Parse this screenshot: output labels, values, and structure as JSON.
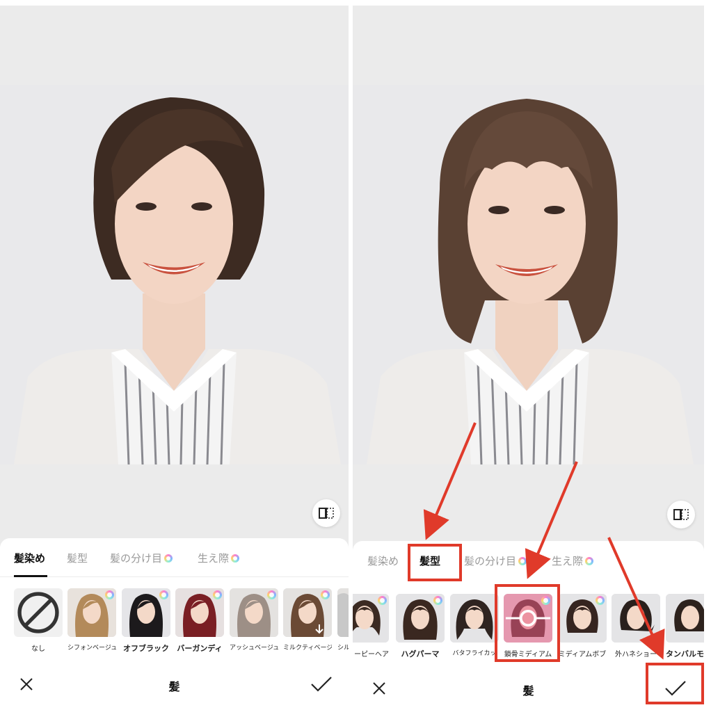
{
  "left_screen": {
    "tabs": [
      {
        "label": "髪染め",
        "active": true,
        "premium": false
      },
      {
        "label": "髪型",
        "active": false,
        "premium": false
      },
      {
        "label": "髪の分け目",
        "active": false,
        "premium": true
      },
      {
        "label": "生え際",
        "active": false,
        "premium": true
      }
    ],
    "items": [
      {
        "label": "なし",
        "type": "none"
      },
      {
        "label": "シフォンベージュ",
        "hair": "#b38a5a",
        "premium": true
      },
      {
        "label": "オフブラック",
        "hair": "#1c1a1c",
        "premium": true
      },
      {
        "label": "バーガンディ",
        "hair": "#7a1f24",
        "premium": true
      },
      {
        "label": "アッシュベージュ",
        "hair": "#9d8f86",
        "premium": true
      },
      {
        "label": "ミルクティベージュ",
        "hair": "#6b4a35",
        "premium": true
      },
      {
        "label": "シル",
        "hair": "#c8c8c8",
        "premium": false
      }
    ],
    "title": "髪"
  },
  "right_screen": {
    "tabs": [
      {
        "label": "髪染め",
        "active": false,
        "premium": false
      },
      {
        "label": "髪型",
        "active": true,
        "premium": false
      },
      {
        "label": "髪の分け目",
        "active": false,
        "premium": true
      },
      {
        "label": "生え際",
        "active": false,
        "premium": true
      }
    ],
    "items": [
      {
        "label": "ーピーヘア",
        "hair": "#3b2a22",
        "premium": true
      },
      {
        "label": "ハグパーマ",
        "hair": "#3a2820",
        "premium": true
      },
      {
        "label": "バタフライカッ",
        "hair": "#2f2420",
        "premium": false
      },
      {
        "label": "鎖骨ミディアム",
        "hair": "#3a2622",
        "premium": true,
        "selected": true
      },
      {
        "label": "ミディアムボブ",
        "hair": "#362520",
        "premium": true
      },
      {
        "label": "外ハネショー",
        "hair": "#2a201c",
        "premium": false
      },
      {
        "label": "タンバルモ",
        "hair": "#2d221d",
        "premium": false
      }
    ],
    "title": "髪"
  },
  "icons": {
    "compare": "compare-icon",
    "close": "close-icon",
    "confirm": "check-icon",
    "none": "prohibited-icon",
    "premium": "gem-icon"
  },
  "colors": {
    "annotation": "#e03a2a",
    "selected_overlay": "#e65a82",
    "active_tab": "#111111",
    "inactive_tab": "#999999"
  }
}
